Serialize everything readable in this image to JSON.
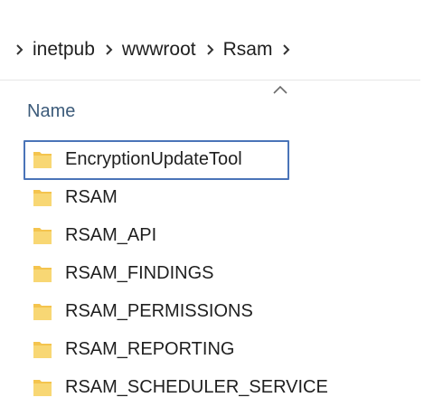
{
  "breadcrumb": {
    "items": [
      {
        "label": "inetpub"
      },
      {
        "label": "wwwroot"
      },
      {
        "label": "Rsam"
      }
    ]
  },
  "list": {
    "column_header": "Name",
    "sort": "ascending",
    "items": [
      {
        "label": "EncryptionUpdateTool",
        "selected": true
      },
      {
        "label": "RSAM"
      },
      {
        "label": "RSAM_API"
      },
      {
        "label": "RSAM_FINDINGS"
      },
      {
        "label": "RSAM_PERMISSIONS"
      },
      {
        "label": "RSAM_REPORTING"
      },
      {
        "label": "RSAM_SCHEDULER_SERVICE"
      }
    ]
  },
  "colors": {
    "folder": "#f4c44e",
    "selection_border": "#4a74b8",
    "header_text": "#3c5b7a"
  }
}
